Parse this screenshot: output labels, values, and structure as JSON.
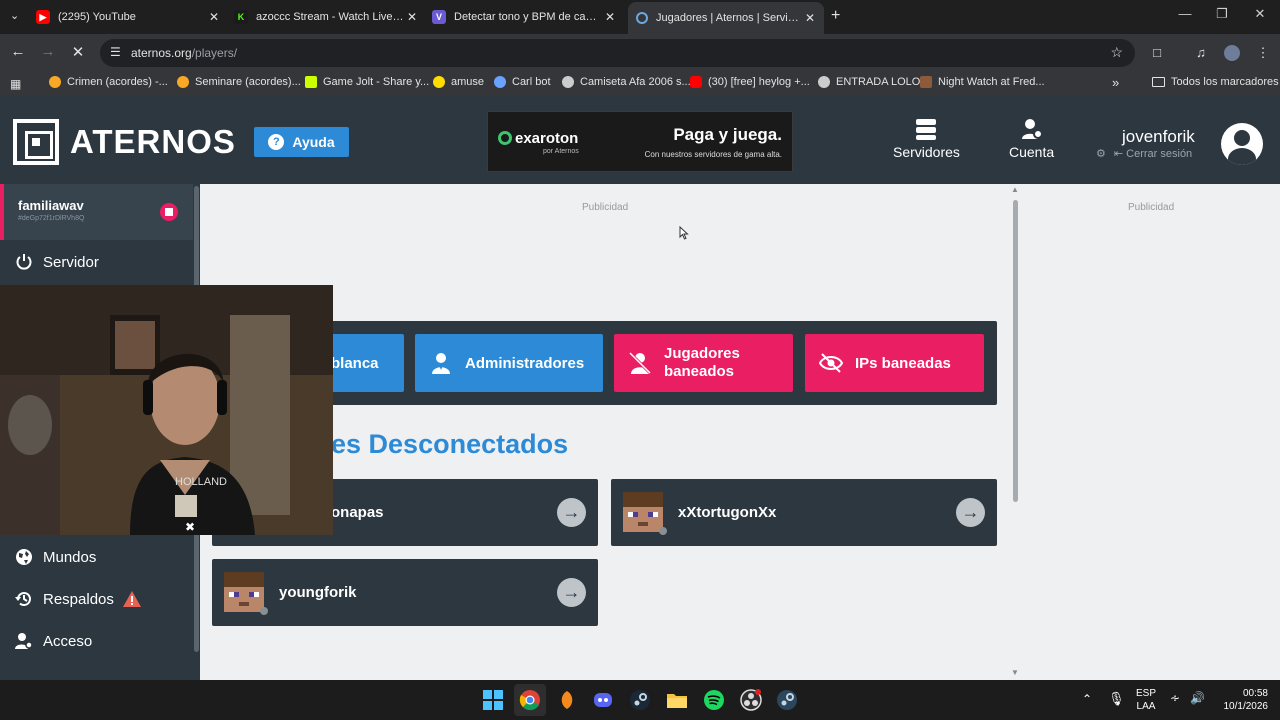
{
  "browser": {
    "tabs": [
      {
        "title": "(2295) YouTube",
        "icon": "youtube-icon",
        "color": "#ff0000"
      },
      {
        "title": "azoccc Stream - Watch Live on Kick",
        "icon": "kick-icon",
        "color": "#53fc18"
      },
      {
        "title": "Detectar tono y BPM de canción",
        "icon": "tunebat-icon",
        "color": "#6b5bd2"
      },
      {
        "title": "Jugadores | Aternos | Servidor de Minecraft",
        "icon": "aternos-icon",
        "color": "#2d8ad6"
      }
    ],
    "url_host": "aternos.org",
    "url_path": "/players/",
    "bookmarks": [
      {
        "label": "Crimen (acordes) -...",
        "icon": "guitar-icon",
        "color": "#f9a825"
      },
      {
        "label": "Seminare (acordes)...",
        "icon": "guitar-icon",
        "color": "#f9a825"
      },
      {
        "label": "Game Jolt - Share y...",
        "icon": "gamejolt-icon",
        "color": "#ccff00"
      },
      {
        "label": "amuse",
        "icon": "amuse-icon",
        "color": "#ffdd00"
      },
      {
        "label": "Carl bot",
        "icon": "carlbot-icon",
        "color": "#6aa3ff"
      },
      {
        "label": "Camiseta Afa 2006 s...",
        "icon": "globe-icon",
        "color": "#cccccc"
      },
      {
        "label": "(30) [free] heylog +...",
        "icon": "youtube-icon",
        "color": "#ff0000"
      },
      {
        "label": "ENTRADA LOLO",
        "icon": "globe-icon",
        "color": "#cccccc"
      },
      {
        "label": "Night Watch at Fred...",
        "icon": "painting-icon",
        "color": "#8d5b3a"
      }
    ],
    "all_bookmarks": "Todos los marcadores"
  },
  "header": {
    "logo": "ATERNOS",
    "help": "Ayuda",
    "ad": {
      "brand": "exaroton",
      "brand_sub": "por Aternos",
      "tagline": "Paga y juega.",
      "tagline_sub": "Con nuestros servidores de gama alta."
    },
    "servers": "Servidores",
    "account": "Cuenta",
    "username": "jovenforik",
    "logout": "Cerrar sesión"
  },
  "sidebar": {
    "server_name": "familiawav",
    "server_id": "#deGp72f1rDlRVh8Q",
    "items": [
      {
        "label": "Servidor",
        "icon": "power-icon"
      },
      {
        "label": "Mundos",
        "icon": "globe-icon"
      },
      {
        "label": "Respaldos",
        "icon": "history-icon",
        "warning": true
      },
      {
        "label": "Acceso",
        "icon": "user-gear-icon"
      }
    ]
  },
  "content": {
    "ad_label_left": "Publicidad",
    "ad_label_right": "Publicidad",
    "tabs": [
      {
        "label": "Lista blanca",
        "color": "#2d8ad6",
        "icon": "list-icon"
      },
      {
        "label": "Administradores",
        "color": "#2d8ad6",
        "icon": "admin-icon"
      },
      {
        "label": "Jugadores baneados",
        "color": "#e91e63",
        "icon": "banned-user-icon"
      },
      {
        "label": "IPs baneadas",
        "color": "#e91e63",
        "icon": "banned-ip-icon"
      }
    ],
    "tab_visible_labels": [
      "blanca",
      "Administradores",
      "Jugadores baneados",
      "IPs baneadas"
    ],
    "section_title": "Jugadores Desconectados",
    "section_title_visible": "es Desconectados",
    "players": [
      {
        "name": "...onapas",
        "visible": "onapas"
      },
      {
        "name": "xXtortugonXx",
        "visible": "xXtortugonXx"
      },
      {
        "name": "youngforik",
        "visible": "youngforik"
      }
    ]
  },
  "taskbar": {
    "lang": "ESP",
    "layout": "LAA",
    "time": "00:58",
    "date": "10/1/2026"
  }
}
